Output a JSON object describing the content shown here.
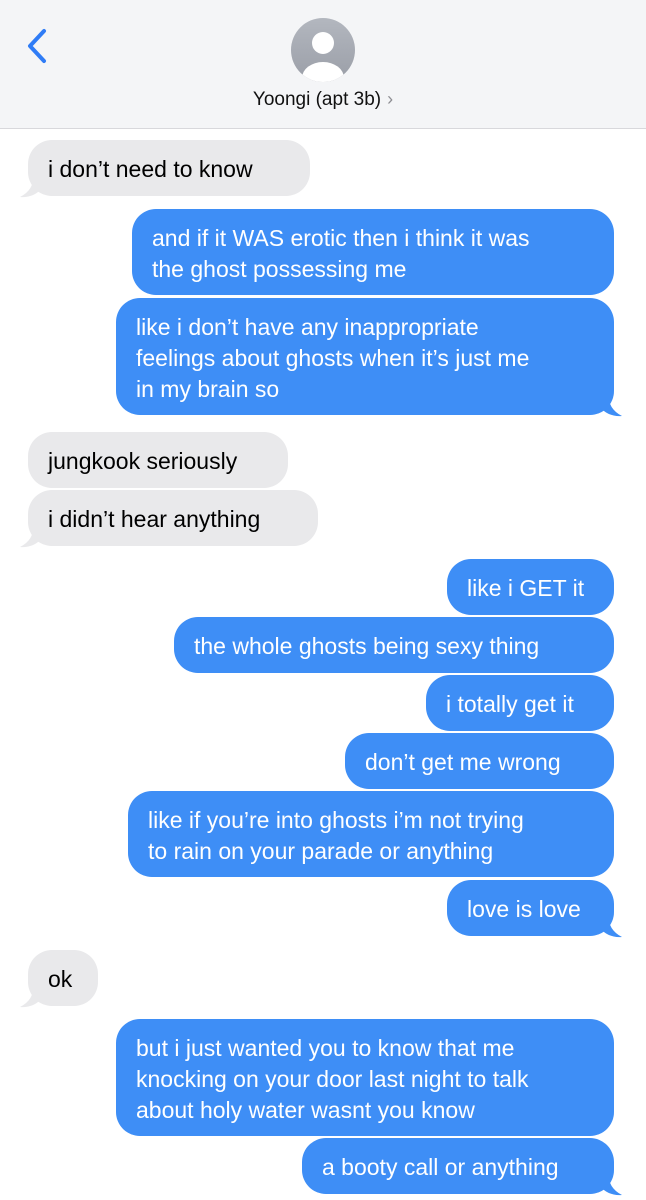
{
  "contact": {
    "name": "Yoongi (apt 3b)",
    "chevron": "›"
  },
  "colors": {
    "incoming": "#e9e9eb",
    "outgoing": "#3e8ef6",
    "accent": "#2f7cf6"
  },
  "messages": [
    {
      "dir": "in",
      "lines": [
        "i don’t need to know"
      ]
    },
    {
      "dir": "out",
      "lines": [
        "and if it WAS erotic then i think it was",
        "the ghost possessing me"
      ]
    },
    {
      "dir": "out",
      "lines": [
        "like i don’t have any inappropriate",
        "feelings about ghosts when it’s just me",
        "in my brain so"
      ]
    },
    {
      "dir": "in",
      "lines": [
        "jungkook seriously"
      ]
    },
    {
      "dir": "in",
      "lines": [
        "i didn’t hear anything"
      ]
    },
    {
      "dir": "out",
      "lines": [
        "like i GET it"
      ]
    },
    {
      "dir": "out",
      "lines": [
        "the whole ghosts being sexy thing"
      ]
    },
    {
      "dir": "out",
      "lines": [
        "i totally get it"
      ]
    },
    {
      "dir": "out",
      "lines": [
        "don’t get me wrong"
      ]
    },
    {
      "dir": "out",
      "lines": [
        "like if you’re into ghosts i’m not trying",
        "to rain on your parade or anything"
      ]
    },
    {
      "dir": "out",
      "lines": [
        "love is love"
      ]
    },
    {
      "dir": "in",
      "lines": [
        "ok"
      ]
    },
    {
      "dir": "out",
      "lines": [
        "but i just wanted you to know that me",
        "knocking on your door last night to talk",
        "about holy water wasnt you know"
      ]
    },
    {
      "dir": "out",
      "lines": [
        "a booty call or anything"
      ]
    }
  ]
}
